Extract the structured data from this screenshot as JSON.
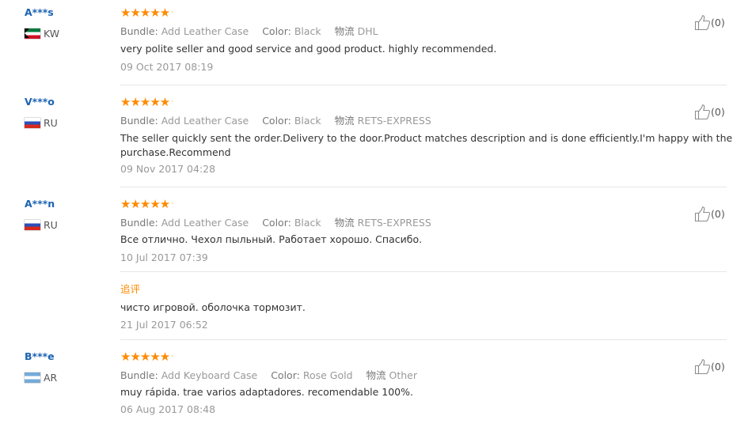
{
  "reviews": [
    {
      "name": "A***s",
      "country": "KW",
      "flag": "kw",
      "stars_icon": "★★★★★",
      "rating": 5,
      "bundle_label": "Bundle:",
      "bundle": "Add Leather Case",
      "color_label": "Color:",
      "color": "Black",
      "shipping_label": "物流",
      "shipping": "DHL",
      "text": "very polite seller and good service and good product. highly recommended.",
      "date": "09 Oct 2017 08:19",
      "helpful": "(0)"
    },
    {
      "name": "V***o",
      "country": "RU",
      "flag": "ru",
      "stars_icon": "★★★★★",
      "rating": 5,
      "bundle_label": "Bundle:",
      "bundle": "Add Leather Case",
      "color_label": "Color:",
      "color": "Black",
      "shipping_label": "物流",
      "shipping": "RETS-EXPRESS",
      "text_line1": "The seller quickly sent the order.Delivery to the door.Product matches description and is done efficiently.I'm happy with the",
      "text_line2": "purchase.Recommend",
      "date": "09 Nov 2017 04:28",
      "helpful": "(0)"
    },
    {
      "name": "A***n",
      "country": "RU",
      "flag": "ru",
      "stars_icon": "★★★★★",
      "rating": 5,
      "bundle_label": "Bundle:",
      "bundle": "Add Leather Case",
      "color_label": "Color:",
      "color": "Black",
      "shipping_label": "物流",
      "shipping": "RETS-EXPRESS",
      "text": "Все отлично. Чехол пыльный. Работает хорошо. Спасибо.",
      "date": "10 Jul 2017 07:39",
      "helpful": "(0)",
      "followup": {
        "title": "追评",
        "text": "чисто игровой. оболочка тормозит.",
        "date": "21 Jul 2017 06:52"
      }
    },
    {
      "name": "B***e",
      "country": "AR",
      "flag": "ar",
      "stars_icon": "★★★★★",
      "rating": 5,
      "bundle_label": "Bundle:",
      "bundle": "Add Keyboard Case",
      "color_label": "Color:",
      "color": "Rose Gold",
      "shipping_label": "物流",
      "shipping": "Other",
      "text": "muy rápida. trae varios adaptadores. recomendable 100%.",
      "date": "06 Aug 2017 08:48",
      "helpful": "(0)"
    }
  ],
  "colors": {
    "name": "#1c63b3",
    "star": "#ff8a00",
    "meta": "#999999",
    "text": "#333333",
    "divider": "#e6e6e6"
  },
  "icons": {
    "like": "thumbs-up-icon",
    "dot": "·"
  }
}
